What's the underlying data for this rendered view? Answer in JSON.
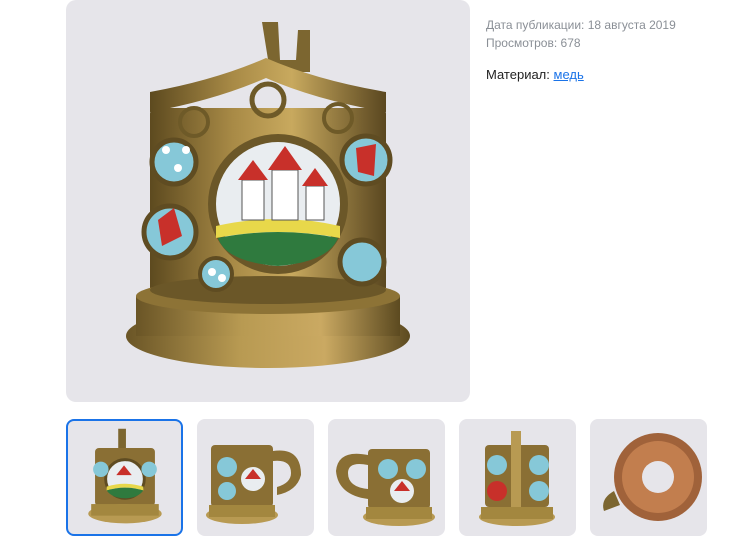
{
  "meta": {
    "published_label": "Дата публикации:",
    "published_value": "18 августа 2019",
    "views_label": "Просмотров:",
    "views_value": "678"
  },
  "material": {
    "label": "Материал:",
    "value": "медь"
  },
  "gallery": {
    "selected_index": 0,
    "thumbnail_count": 5
  },
  "colors": {
    "accent": "#1a73e8",
    "photo_background": "#e6e5ea",
    "brass": "#9c7d3c",
    "enamel_blue": "#86c8d8",
    "enamel_red": "#c8302a"
  }
}
